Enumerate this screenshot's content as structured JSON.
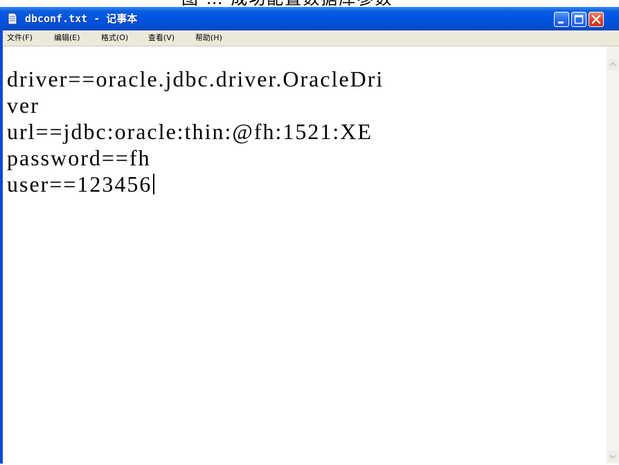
{
  "document": {
    "caption_fragment": "图 … 成功配置数据库参数"
  },
  "window": {
    "title": "dbconf.txt - 记事本",
    "controls": {
      "minimize": "minimize",
      "maximize": "maximize",
      "close": "close"
    }
  },
  "menu": {
    "items": [
      "文件(F)",
      "编辑(E)",
      "格式(O)",
      "查看(V)",
      "帮助(H)"
    ]
  },
  "editor": {
    "lines": [
      "driver==oracle.jdbc.driver.OracleDri",
      "ver",
      "url==jdbc:oracle:thin:@fh:1521:XE",
      "password==fh",
      "user==123456"
    ]
  },
  "icons": {
    "notepad": "notepad-icon",
    "minimize": "minimize-icon",
    "maximize": "maximize-icon",
    "close": "close-icon",
    "scroll_up": "chevron-up-icon",
    "scroll_down": "chevron-down-icon"
  },
  "colors": {
    "titlebar": "#0054e3",
    "menubar": "#ece9d8",
    "close": "#e0462a"
  }
}
